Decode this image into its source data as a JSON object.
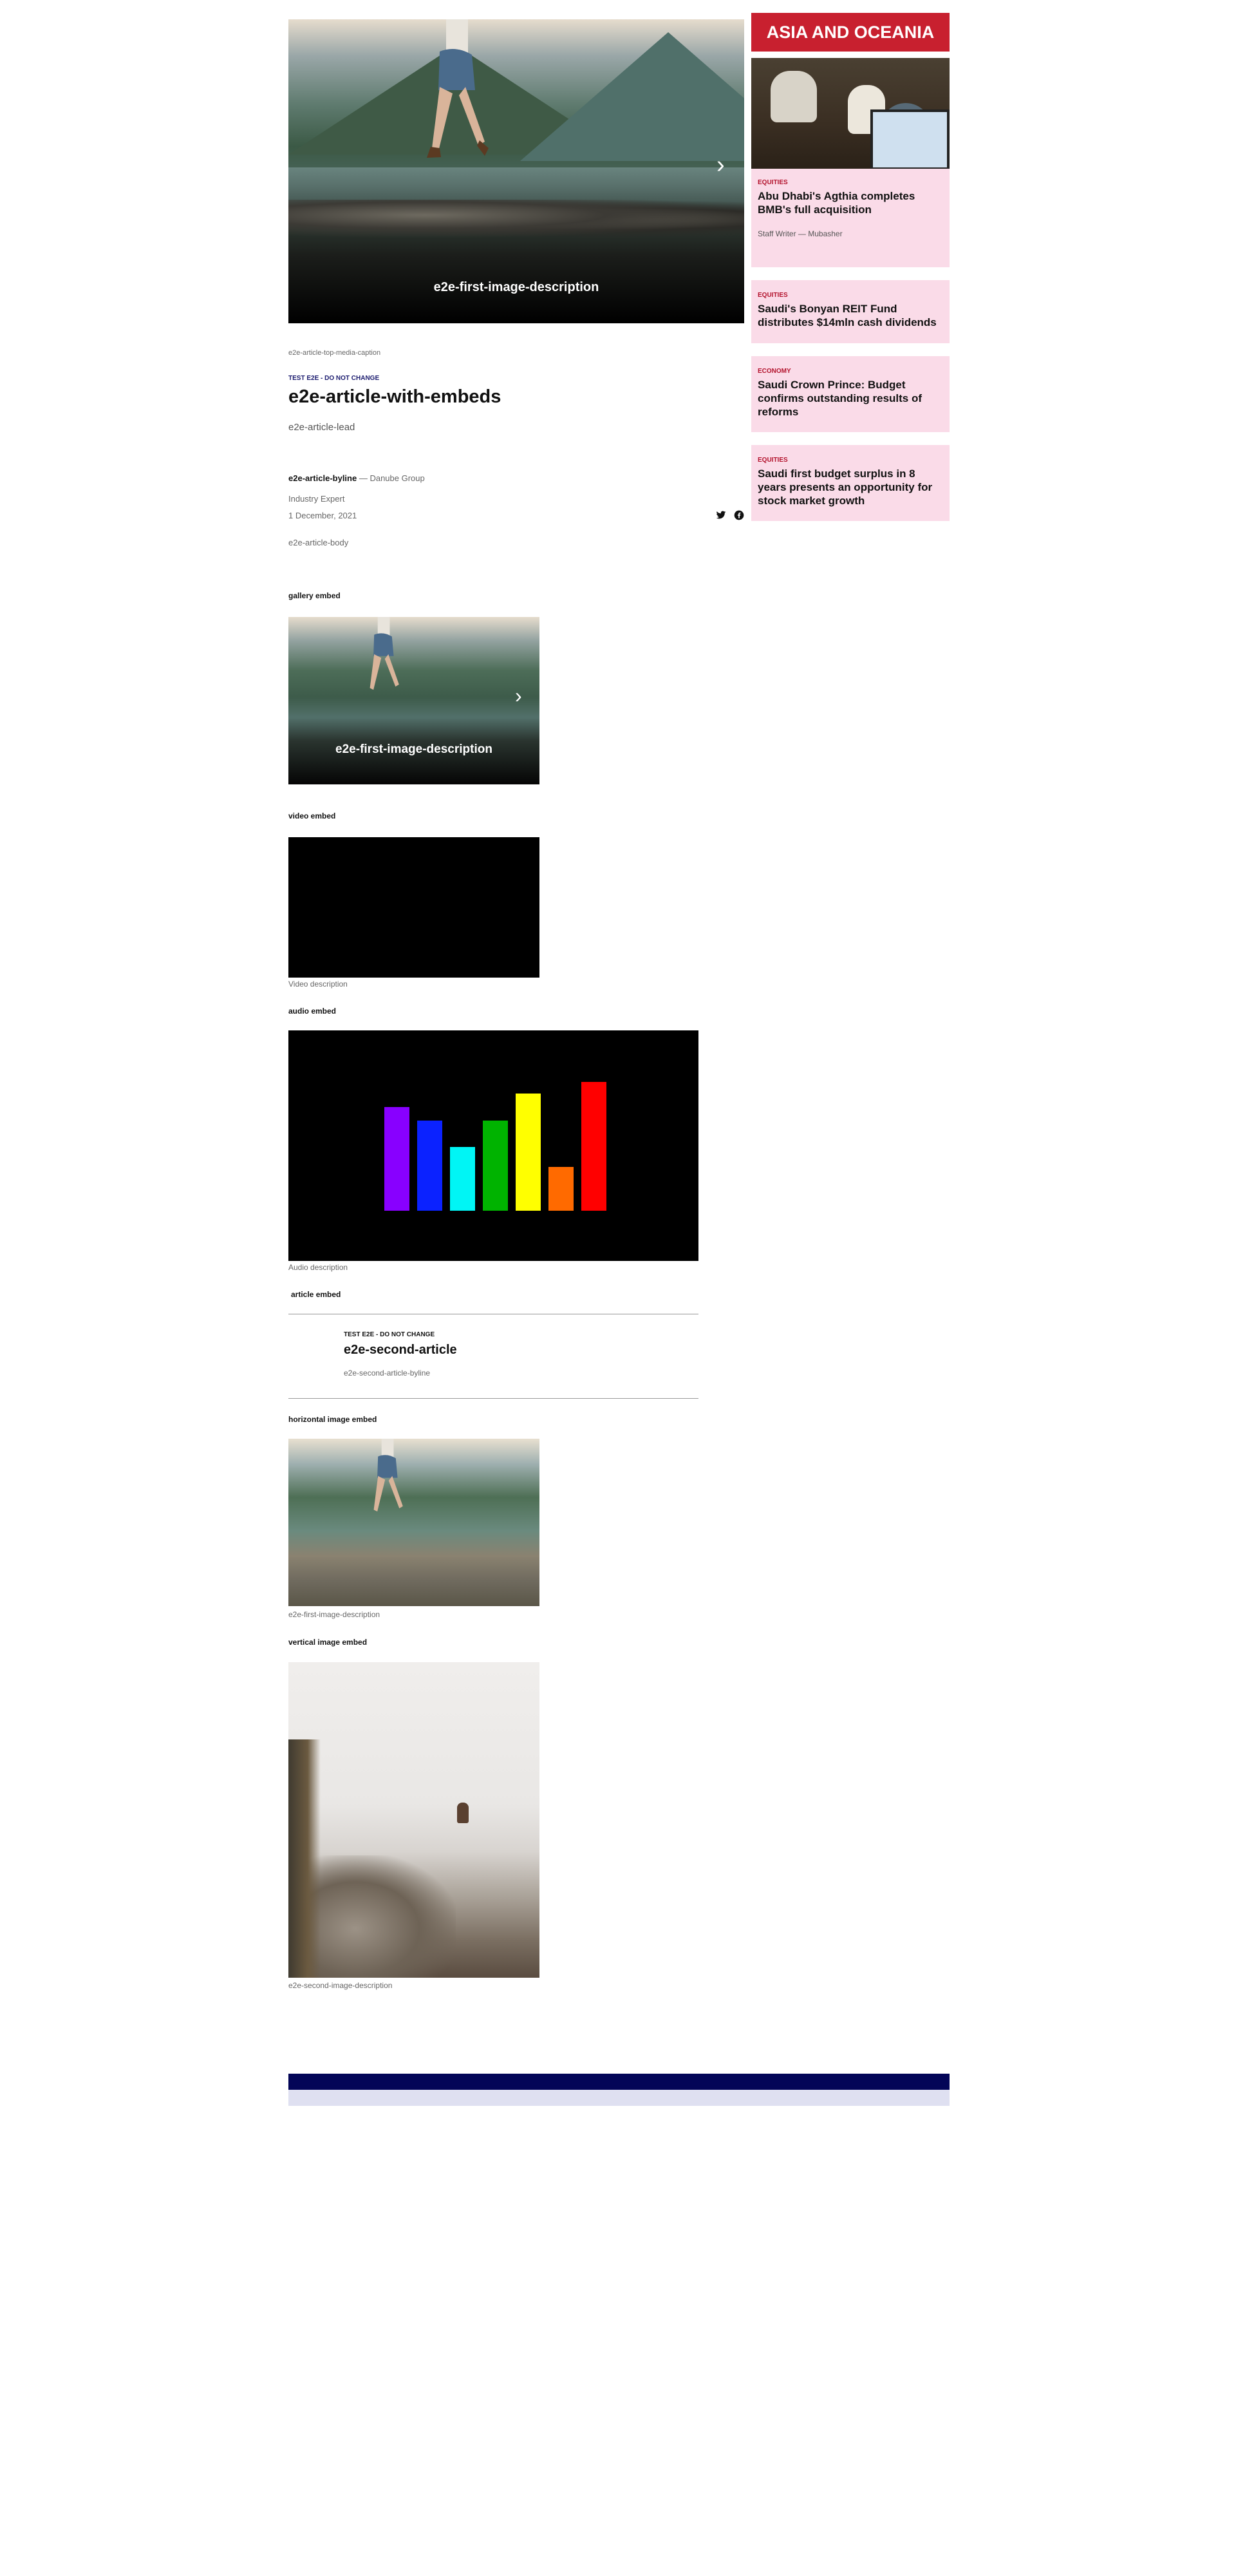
{
  "hero": {
    "caption": "e2e-first-image-description",
    "media_caption": "e2e-article-top-media-caption"
  },
  "article": {
    "kicker": "TEST E2E - DO NOT CHANGE",
    "title": "e2e-article-with-embeds",
    "lead": "e2e-article-lead",
    "byline_name": "e2e-article-byline",
    "byline_org": "— Danube Group",
    "role": "Industry Expert",
    "date": "1 December, 2021",
    "body": "e2e-article-body"
  },
  "embeds": {
    "gallery_label": "gallery embed",
    "gallery_caption": "e2e-first-image-description",
    "video_label": "video embed",
    "video_description": "Video description",
    "audio_label": "audio embed",
    "audio_description": "Audio description",
    "audio_bar_colors": [
      "#8800ff",
      "#0b22ff",
      "#00f5f5",
      "#00b300",
      "#ffff00",
      "#ff6a00",
      "#ff0000"
    ],
    "audio_bar_levels": [
      0.62,
      0.54,
      0.38,
      0.54,
      0.7,
      0.26,
      0.77
    ],
    "article_label": "article embed",
    "article_kicker": "TEST E2E - DO NOT CHANGE",
    "article_title": "e2e-second-article",
    "article_byline": "e2e-second-article-byline",
    "horizontal_label": "horizontal image embed",
    "horizontal_caption": "e2e-first-image-description",
    "vertical_label": "vertical image embed",
    "vertical_caption": "e2e-second-image-description"
  },
  "sidebar": {
    "header": "ASIA AND OCEANIA",
    "cards": [
      {
        "category": "EQUITIES",
        "title": "Abu Dhabi's Agthia completes BMB's full acquisition",
        "author": "Staff Writer — Mubasher"
      },
      {
        "category": "EQUITIES",
        "title": "Saudi's Bonyan REIT Fund distributes $14mln cash dividends"
      },
      {
        "category": "ECONOMY",
        "title": "Saudi Crown Prince: Budget confirms outstanding results of reforms"
      },
      {
        "category": "EQUITIES",
        "title": "Saudi first budget surplus in 8 years presents an opportunity for stock market growth"
      }
    ]
  },
  "colors": {
    "accent_red": "#c8202f",
    "card_pink": "#fadbe8",
    "footer_navy": "#030557",
    "footer_light": "#dfe0f1"
  },
  "icons": {
    "share": [
      "twitter-icon",
      "facebook-icon"
    ],
    "carousel_next": "chevron-right-icon"
  }
}
